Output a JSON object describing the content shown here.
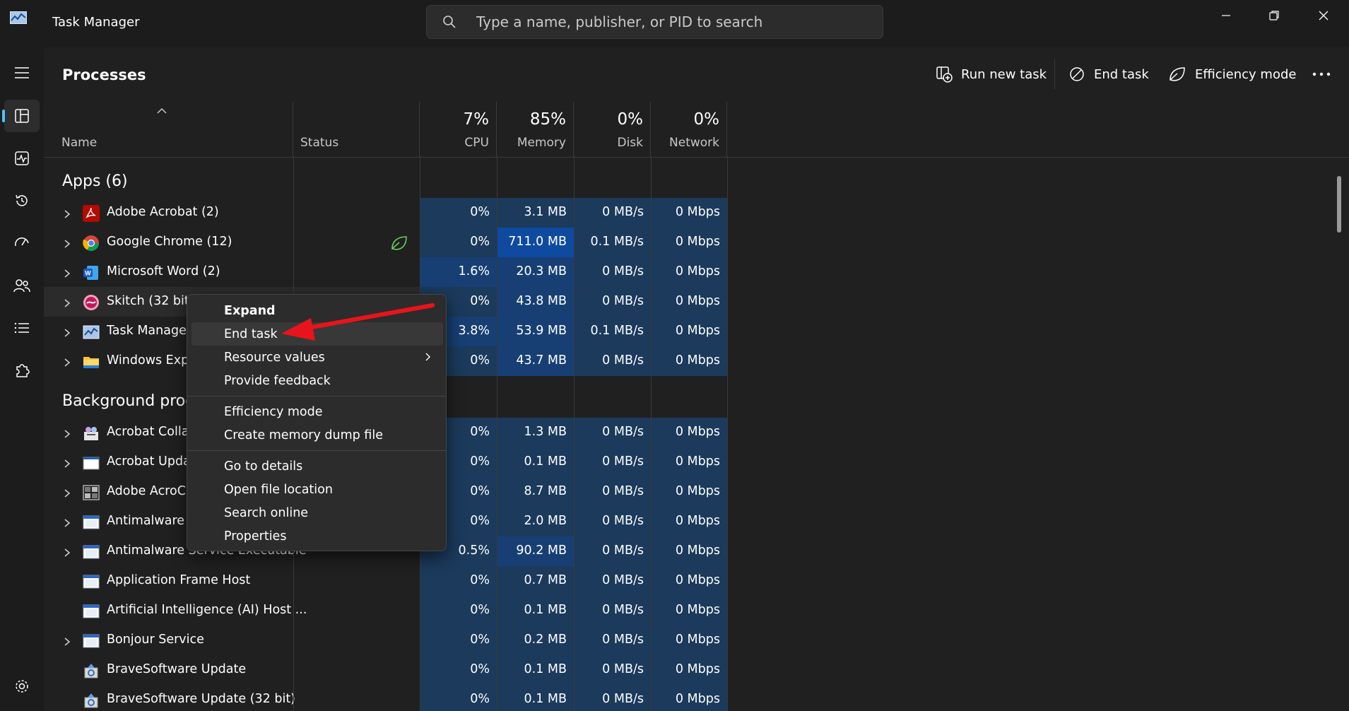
{
  "titlebar": {
    "title": "Task Manager",
    "search_placeholder": "Type a name, publisher, or PID to search"
  },
  "header": {
    "page_title": "Processes",
    "run_new_task": "Run new task",
    "end_task": "End task",
    "efficiency_mode": "Efficiency mode"
  },
  "columns": {
    "name": "Name",
    "status": "Status",
    "cpu_pct": "7%",
    "cpu": "CPU",
    "memory_pct": "85%",
    "memory": "Memory",
    "disk_pct": "0%",
    "disk": "Disk",
    "network_pct": "0%",
    "network": "Network"
  },
  "apps": {
    "title": "Apps (6)",
    "rows": [
      {
        "name": "Adobe Acrobat (2)",
        "cpu": "0%",
        "mem": "3.1 MB",
        "disk": "0 MB/s",
        "net": "0 Mbps",
        "icon": "acrobat-icon"
      },
      {
        "name": "Google Chrome (12)",
        "cpu": "0%",
        "mem": "711.0 MB",
        "disk": "0.1 MB/s",
        "net": "0 Mbps",
        "icon": "chrome-icon"
      },
      {
        "name": "Microsoft Word (2)",
        "cpu": "1.6%",
        "mem": "20.3 MB",
        "disk": "0 MB/s",
        "net": "0 Mbps",
        "icon": "word-icon"
      },
      {
        "name": "Skitch (32 bit)",
        "cpu": "0%",
        "mem": "43.8 MB",
        "disk": "0 MB/s",
        "net": "0 Mbps",
        "icon": "skitch-icon"
      },
      {
        "name": "Task Manager",
        "cpu": "3.8%",
        "mem": "53.9 MB",
        "disk": "0.1 MB/s",
        "net": "0 Mbps",
        "icon": "task-manager-icon"
      },
      {
        "name": "Windows Expl",
        "cpu": "0%",
        "mem": "43.7 MB",
        "disk": "0 MB/s",
        "net": "0 Mbps",
        "icon": "folder-icon"
      }
    ]
  },
  "background": {
    "title": "Background proc",
    "rows": [
      {
        "name": "Acrobat Collab",
        "cpu": "0%",
        "mem": "1.3 MB",
        "disk": "0 MB/s",
        "net": "0 Mbps",
        "icon": "acrobat-collab-icon"
      },
      {
        "name": "Acrobat Upda",
        "cpu": "0%",
        "mem": "0.1 MB",
        "disk": "0 MB/s",
        "net": "0 Mbps",
        "icon": "window-icon"
      },
      {
        "name": "Adobe AcroCE",
        "cpu": "0%",
        "mem": "8.7 MB",
        "disk": "0 MB/s",
        "net": "0 Mbps",
        "icon": "grid-icon"
      },
      {
        "name": "Antimalware C",
        "cpu": "0%",
        "mem": "2.0 MB",
        "disk": "0 MB/s",
        "net": "0 Mbps",
        "icon": "service-icon"
      },
      {
        "name": "Antimalware Service Executable",
        "cpu": "0.5%",
        "mem": "90.2 MB",
        "disk": "0 MB/s",
        "net": "0 Mbps",
        "icon": "service-icon"
      },
      {
        "name": "Application Frame Host",
        "cpu": "0%",
        "mem": "0.7 MB",
        "disk": "0 MB/s",
        "net": "0 Mbps",
        "icon": "service-icon"
      },
      {
        "name": "Artificial Intelligence (AI) Host ...",
        "cpu": "0%",
        "mem": "0.1 MB",
        "disk": "0 MB/s",
        "net": "0 Mbps",
        "icon": "service-icon"
      },
      {
        "name": "Bonjour Service",
        "cpu": "0%",
        "mem": "0.2 MB",
        "disk": "0 MB/s",
        "net": "0 Mbps",
        "icon": "service-icon"
      },
      {
        "name": "BraveSoftware Update",
        "cpu": "0%",
        "mem": "0.1 MB",
        "disk": "0 MB/s",
        "net": "0 Mbps",
        "icon": "installer-icon"
      },
      {
        "name": "BraveSoftware Update (32 bit)",
        "cpu": "0%",
        "mem": "0.1 MB",
        "disk": "0 MB/s",
        "net": "0 Mbps",
        "icon": "installer-icon"
      }
    ]
  },
  "context_menu": {
    "expand": "Expand",
    "end_task": "End task",
    "resource_values": "Resource values",
    "provide_feedback": "Provide feedback",
    "efficiency_mode": "Efficiency mode",
    "create_dump": "Create memory dump file",
    "go_to_details": "Go to details",
    "open_file_location": "Open file location",
    "search_online": "Search online",
    "properties": "Properties"
  },
  "colors": {
    "accent": "#4cc2ff",
    "heat_low": "#1b3a5c",
    "heat_mid": "#173f73",
    "heat_high": "#0e4aa0",
    "annotation": "#e8141b"
  }
}
